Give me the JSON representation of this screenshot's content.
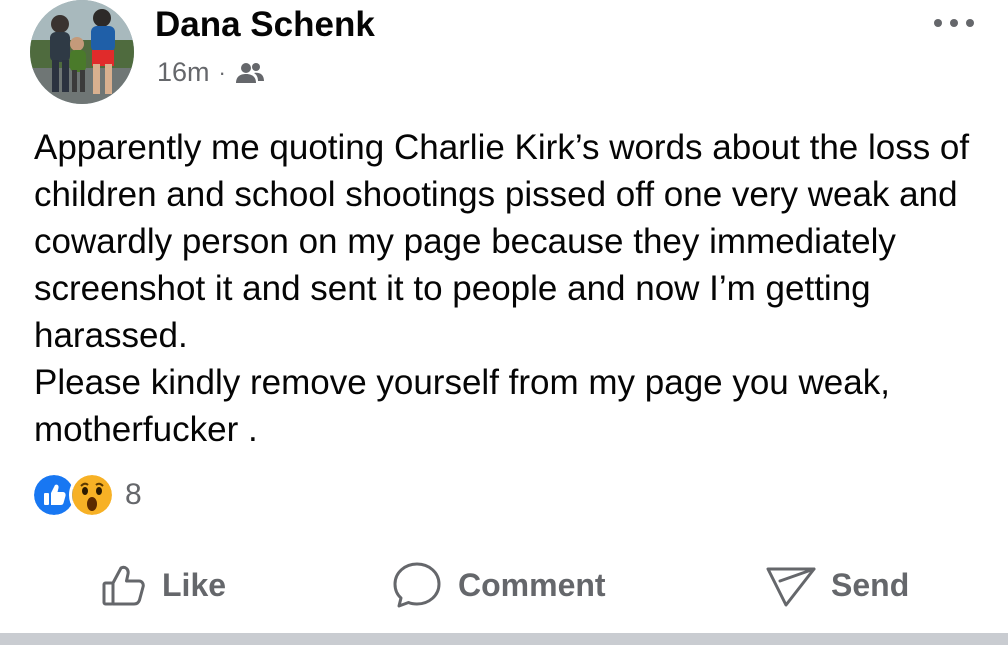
{
  "post": {
    "author_name": "Dana Schenk",
    "timestamp": "16m",
    "separator": "·",
    "audience_icon": "friends-icon",
    "more_icon": "more-horizontal-icon",
    "text_lines": [
      "Apparently me quoting Charlie Kirk’s words about the loss of children and school shootings pissed off one very weak and cowardly person on my page because they immediately screenshot it and sent it to people and now I’m getting harassed.",
      "Please kindly remove yourself from my page you weak, motherfucker ."
    ]
  },
  "reactions": {
    "icons": [
      "like-reaction-icon",
      "wow-reaction-icon"
    ],
    "count": "8"
  },
  "actions": {
    "like_label": "Like",
    "comment_label": "Comment",
    "send_label": "Send"
  },
  "colors": {
    "text_primary": "#050505",
    "text_secondary": "#65676b",
    "like_blue": "#1877f2",
    "wow_yellow": "#f7b125",
    "divider": "#c9ccd1"
  }
}
